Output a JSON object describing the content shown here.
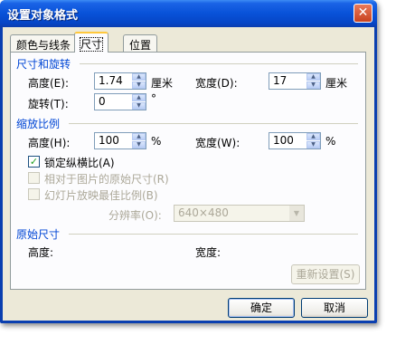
{
  "dialog": {
    "title": "设置对象格式",
    "close_glyph": "✕"
  },
  "tabs": [
    {
      "label": "颜色与线条",
      "active": false
    },
    {
      "label": "尺寸",
      "active": true
    },
    {
      "label": "位置",
      "active": false
    }
  ],
  "size_rotate": {
    "section_label": "尺寸和旋转",
    "height_label": "高度(E):",
    "height_value": "1.74",
    "height_unit": "厘米",
    "width_label": "宽度(D):",
    "width_value": "17",
    "width_unit": "厘米",
    "rotation_label": "旋转(T):",
    "rotation_value": "0",
    "rotation_unit": "°"
  },
  "scale": {
    "section_label": "缩放比例",
    "height_label": "高度(H):",
    "height_value": "100",
    "height_unit": "%",
    "width_label": "宽度(W):",
    "width_value": "100",
    "width_unit": "%",
    "lock_aspect_label": "锁定纵横比(A)",
    "lock_aspect_checked": true,
    "relative_original_label": "相对于图片的原始尺寸(R)",
    "best_scale_label": "幻灯片放映最佳比例(B)",
    "resolution_label": "分辨率(O):",
    "resolution_value": "640×480"
  },
  "original": {
    "section_label": "原始尺寸",
    "height_label": "高度:",
    "width_label": "宽度:",
    "reset_label": "重新设置(S)"
  },
  "footer": {
    "ok_label": "确定",
    "cancel_label": "取消"
  },
  "colors": {
    "titlebar": "#0852d8",
    "section_text": "#0046d5",
    "disabled_text": "#aca899",
    "dialog_bg": "#ece9d8"
  }
}
